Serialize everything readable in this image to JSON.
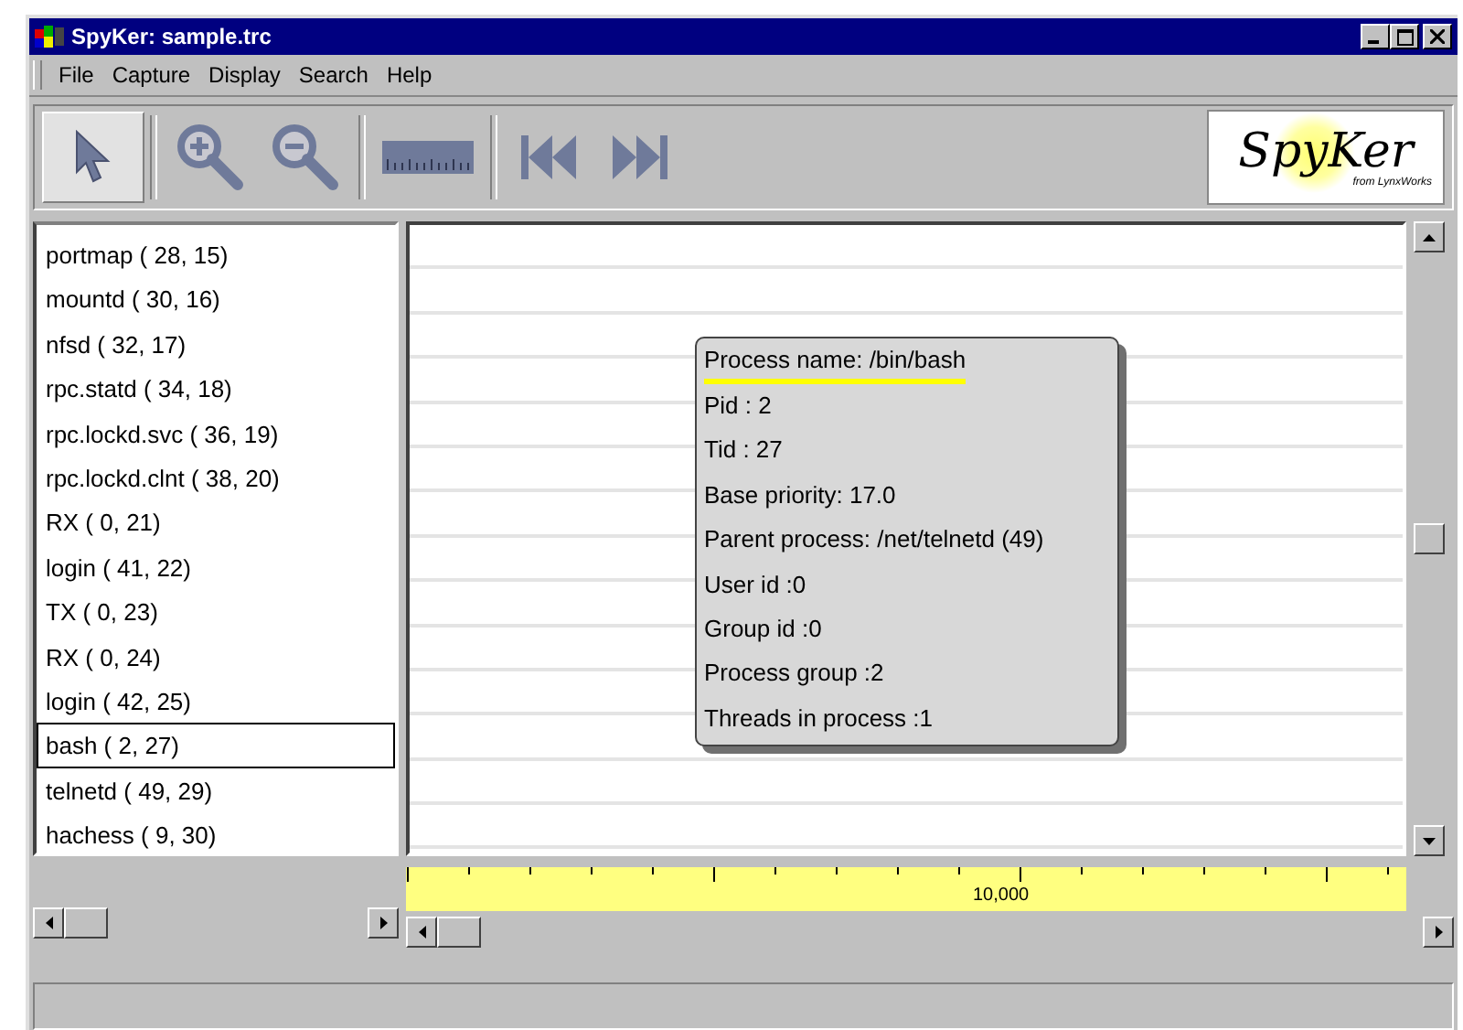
{
  "window": {
    "title": "SpyKer: sample.trc"
  },
  "menu": [
    "File",
    "Capture",
    "Display",
    "Search",
    "Help"
  ],
  "toolbar": [
    {
      "kind": "pointer",
      "selected": true
    },
    {
      "kind": "zoom-in",
      "selected": false
    },
    {
      "kind": "zoom-out",
      "selected": false
    },
    {
      "kind": "ruler",
      "selected": false
    },
    {
      "kind": "skip-back",
      "selected": false
    },
    {
      "kind": "skip-forward",
      "selected": false
    }
  ],
  "logo": {
    "name": "SpyKer",
    "tagline": "from LynxWorks"
  },
  "processes": [
    {
      "label": "portmap ( 28, 15)",
      "selected": false
    },
    {
      "label": "mountd ( 30, 16)",
      "selected": false
    },
    {
      "label": "nfsd ( 32, 17)",
      "selected": false
    },
    {
      "label": "rpc.statd ( 34, 18)",
      "selected": false
    },
    {
      "label": "rpc.lockd.svc ( 36, 19)",
      "selected": false
    },
    {
      "label": "rpc.lockd.clnt ( 38, 20)",
      "selected": false
    },
    {
      "label": "RX ( 0, 21)",
      "selected": false
    },
    {
      "label": "login ( 41, 22)",
      "selected": false
    },
    {
      "label": "TX ( 0, 23)",
      "selected": false
    },
    {
      "label": "RX ( 0, 24)",
      "selected": false
    },
    {
      "label": "login ( 42, 25)",
      "selected": false
    },
    {
      "label": "bash ( 2, 27)",
      "selected": true
    },
    {
      "label": "telnetd ( 49, 29)",
      "selected": false
    },
    {
      "label": "hachess ( 9, 30)",
      "selected": false
    }
  ],
  "tooltip": {
    "title": "Process name: /bin/bash",
    "lines": [
      "Pid : 2",
      "Tid : 27",
      "Base priority: 17.0",
      "Parent process: /net/telnetd (49)",
      "User id :0",
      "Group id :0",
      "Process group :2",
      "Threads in process :1"
    ]
  },
  "ruler": {
    "label": "10,000"
  }
}
